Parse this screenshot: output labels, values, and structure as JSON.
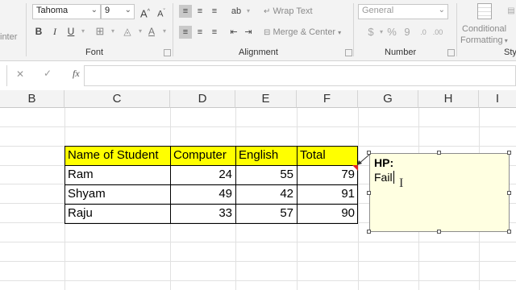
{
  "ribbon": {
    "left_cut_label": "inter",
    "font": {
      "name": "Tahoma",
      "size": "9",
      "grow_glyph": "A",
      "shrink_glyph": "A",
      "bold": "B",
      "italic": "I",
      "underline": "U",
      "group_label": "Font"
    },
    "alignment": {
      "wrap_text": "Wrap Text",
      "merge_center": "Merge & Center",
      "group_label": "Alignment"
    },
    "number": {
      "format": "General",
      "currency": "$",
      "percent": "%",
      "comma": "9",
      "group_label": "Number"
    },
    "styles": {
      "conditional_formatting_line1": "Conditional",
      "conditional_formatting_line2": "Formatting",
      "group_label_cut": "Sty"
    }
  },
  "formula_bar": {
    "cancel": "✕",
    "enter": "✓",
    "fx": "fx",
    "value": ""
  },
  "columns": [
    "B",
    "C",
    "D",
    "E",
    "F",
    "G",
    "H",
    "I"
  ],
  "table": {
    "headers": [
      "Name of Student",
      "Computer",
      "English",
      "Total"
    ],
    "rows": [
      {
        "name": "Ram",
        "computer": "24",
        "english": "55",
        "total": "79"
      },
      {
        "name": "Shyam",
        "computer": "49",
        "english": "42",
        "total": "91"
      },
      {
        "name": "Raju",
        "computer": "33",
        "english": "57",
        "total": "90"
      }
    ]
  },
  "comment": {
    "author": "HP:",
    "text": "Fail"
  },
  "colors": {
    "header_fill": "#ffff00",
    "comment_fill": "#ffffe1",
    "indicator": "#e02020"
  }
}
